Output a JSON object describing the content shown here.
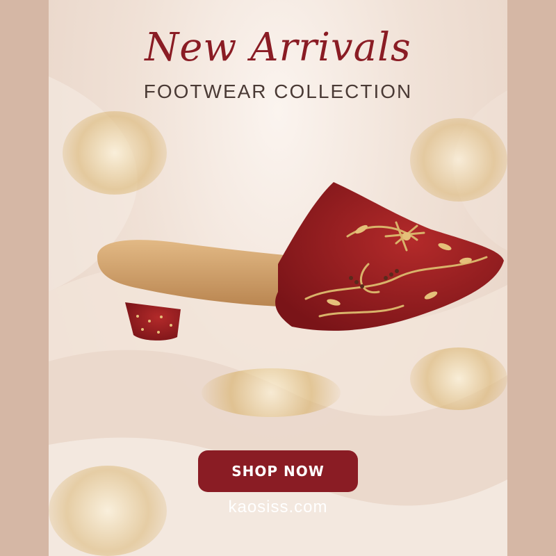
{
  "hero": {
    "title": "New Arrivals",
    "subtitle": "FOOTWEAR COLLECTION"
  },
  "cta": {
    "label": "SHOP NOW"
  },
  "footer": {
    "website": "kaosiss.com"
  },
  "colors": {
    "accent": "#8a1c24",
    "background_border": "#d5b7a5",
    "gold": "#d8b26a"
  },
  "image": {
    "name": "embroidered-red-mule-heel-image"
  }
}
